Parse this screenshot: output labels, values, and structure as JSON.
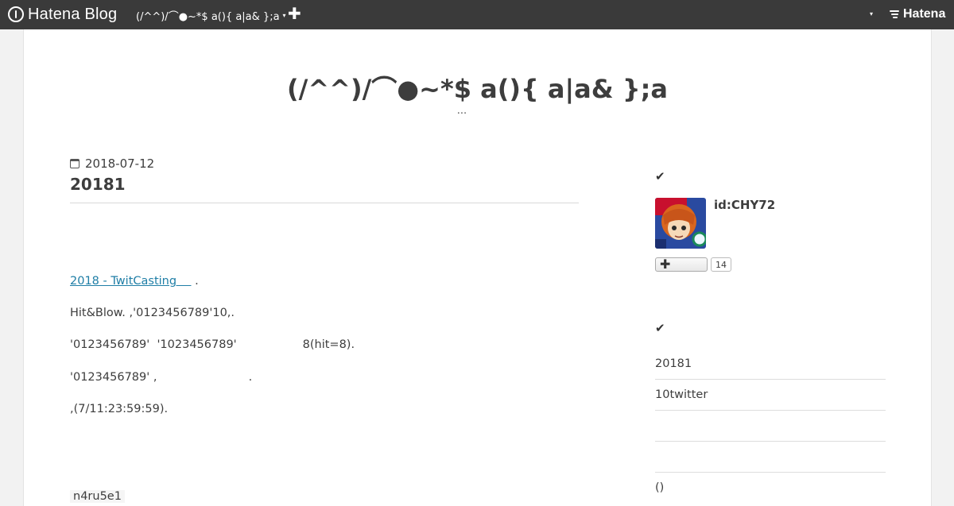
{
  "topbar": {
    "logo_text": "Hatena Blog",
    "blog_menu_label": "(/^^)/⌒●~*$ a(){ a|a& };a",
    "caret": "▾",
    "add_label": "✚",
    "hatena_label": "Hatena"
  },
  "blog": {
    "title": "(/^^)/⌒●~*$ a(){ a|a& };a",
    "description": "..."
  },
  "entry": {
    "date": "2018-07-12",
    "title": "20181",
    "link_text": "2018 - TwitCasting    ",
    "link_suffix": " .",
    "paragraphs": [
      "Hit&Blow. ,'0123456789'10,.",
      "'0123456789'  '1023456789'                  8(hit=8).",
      "'0123456789' ,                         .",
      ",(7/11:23:59:59).",
      "n4ru5e1"
    ]
  },
  "sidebar": {
    "check_icon": "✔",
    "profile_id": "id:CHY72",
    "follow_icon": "✚",
    "follow_count": "14",
    "recent_items": [
      "20181",
      "10twitter",
      "",
      "",
      "()"
    ]
  },
  "colors": {
    "topbar_bg": "#3a3a3a",
    "link": "#1f7ea6",
    "page_bg": "#f2f2f2"
  }
}
